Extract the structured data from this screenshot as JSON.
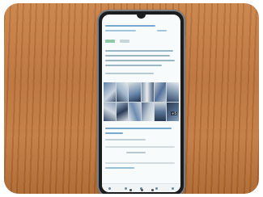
{
  "scene": {
    "surface": "wooden-table",
    "device": "smartphone",
    "screen_theme_color": "#4a8fbf"
  },
  "phone_screen": {
    "statusbar": {
      "time": "",
      "battery": ""
    },
    "photo_badge": "+5",
    "icons": [
      "back-icon",
      "home-icon",
      "recents-icon"
    ]
  }
}
